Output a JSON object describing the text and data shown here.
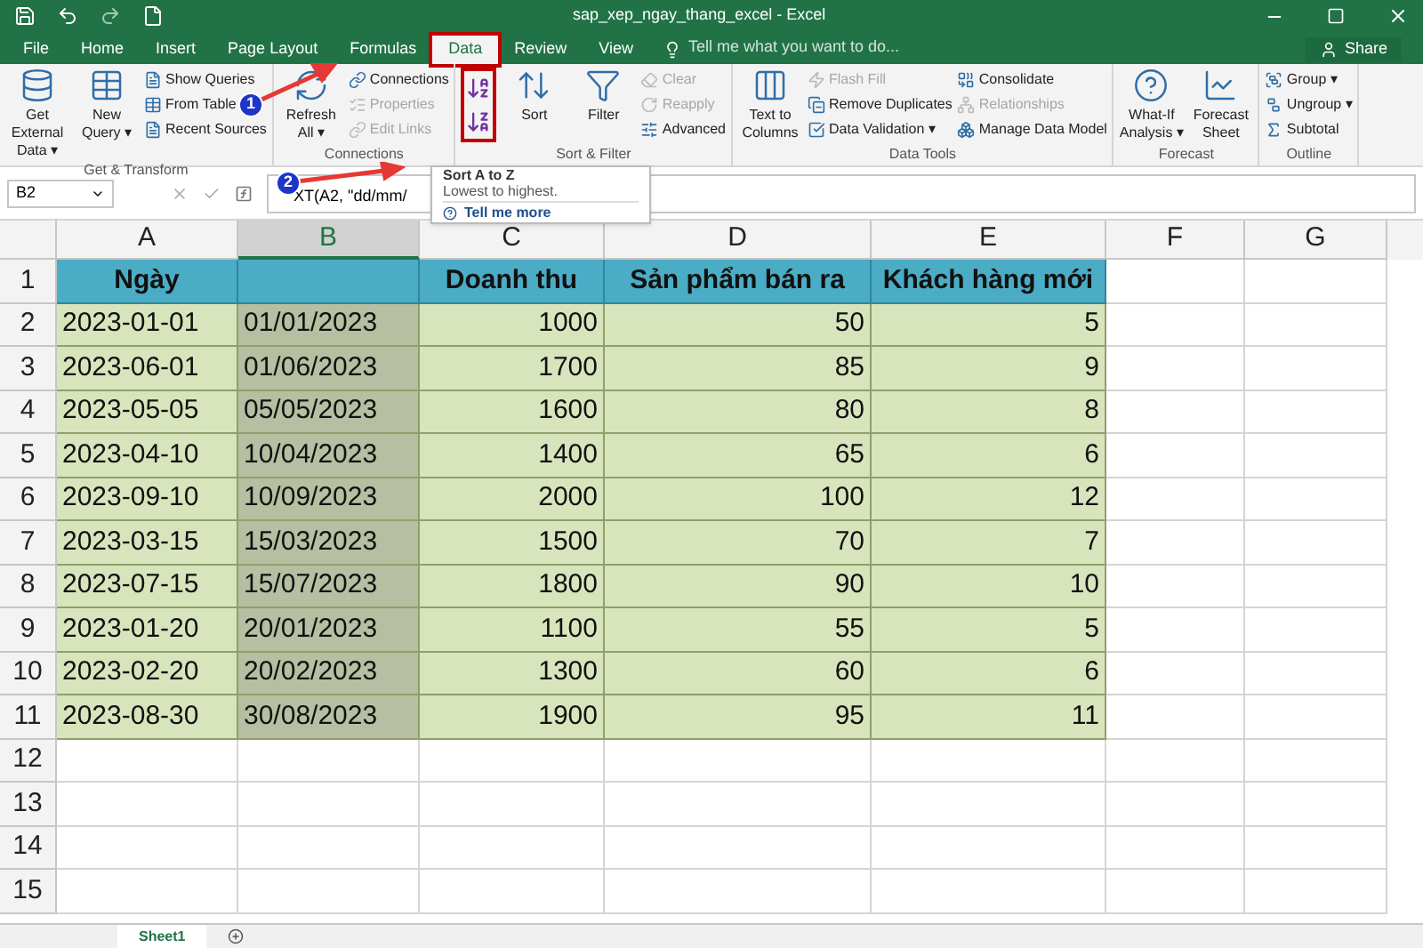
{
  "window": {
    "title": "sap_xep_ngay_thang_excel - Excel",
    "search_placeholder": "Tell me what you want to do...",
    "share": "Share"
  },
  "tabs": [
    {
      "label": "File",
      "selected": false
    },
    {
      "label": "Home",
      "selected": false
    },
    {
      "label": "Insert",
      "selected": false
    },
    {
      "label": "Page Layout",
      "selected": false
    },
    {
      "label": "Formulas",
      "selected": false
    },
    {
      "label": "Data",
      "selected": true
    },
    {
      "label": "Review",
      "selected": false
    },
    {
      "label": "View",
      "selected": false
    }
  ],
  "ribbon": [
    {
      "name": "Get & Transform",
      "items": [
        {
          "kind": "large",
          "label": "Get External Data ▾",
          "disabled": false
        },
        {
          "kind": "large",
          "label": "New Query ▾",
          "disabled": false
        },
        {
          "kind": "small",
          "label": "Show Queries",
          "disabled": false
        },
        {
          "kind": "small",
          "label": "From Table",
          "disabled": false
        },
        {
          "kind": "small",
          "label": "Recent Sources",
          "disabled": false
        }
      ]
    },
    {
      "name": "Connections",
      "items": [
        {
          "kind": "large",
          "label": "Refresh All ▾",
          "disabled": false
        },
        {
          "kind": "small",
          "label": "Connections",
          "disabled": false
        },
        {
          "kind": "small",
          "label": "Properties",
          "disabled": true
        },
        {
          "kind": "small",
          "label": "Edit Links",
          "disabled": true
        }
      ]
    },
    {
      "name": "Sort & Filter",
      "items": [
        {
          "kind": "sort",
          "disabled": false
        },
        {
          "kind": "large",
          "label": "Sort",
          "disabled": false
        },
        {
          "kind": "large",
          "label": "Filter",
          "disabled": false
        },
        {
          "kind": "small",
          "label": "Clear",
          "disabled": true
        },
        {
          "kind": "small",
          "label": "Reapply",
          "disabled": true
        },
        {
          "kind": "small",
          "label": "Advanced",
          "disabled": false
        }
      ]
    },
    {
      "name": "Data Tools",
      "items": [
        {
          "kind": "large",
          "label": "Text to Columns",
          "disabled": false
        },
        {
          "kind": "small",
          "label": "Flash Fill",
          "disabled": true
        },
        {
          "kind": "small",
          "label": "Remove Duplicates",
          "disabled": false
        },
        {
          "kind": "small",
          "label": "Data Validation ▾",
          "disabled": false
        },
        {
          "kind": "small",
          "label": "Consolidate",
          "disabled": false
        },
        {
          "kind": "small",
          "label": "Relationships",
          "disabled": true
        },
        {
          "kind": "small",
          "label": "Manage Data Model",
          "disabled": false
        }
      ]
    },
    {
      "name": "Forecast",
      "items": [
        {
          "kind": "large",
          "label": "What-If Analysis ▾",
          "disabled": false
        },
        {
          "kind": "large",
          "label": "Forecast Sheet",
          "disabled": false
        }
      ]
    },
    {
      "name": "Outline",
      "items": [
        {
          "kind": "small",
          "label": "Group ▾",
          "disabled": false
        },
        {
          "kind": "small",
          "label": "Ungroup ▾",
          "disabled": false
        },
        {
          "kind": "small",
          "label": "Subtotal",
          "disabled": false
        }
      ]
    }
  ],
  "formula_bar": {
    "name_box": "B2",
    "formula": "XT(A2, \"dd/mm/"
  },
  "tooltip": {
    "title": "Sort A to Z",
    "description": "Lowest to highest.",
    "link": "Tell me more"
  },
  "columns": [
    {
      "label": "A",
      "selected": false
    },
    {
      "label": "B",
      "selected": true
    },
    {
      "label": "C",
      "selected": false
    },
    {
      "label": "D",
      "selected": false
    },
    {
      "label": "E",
      "selected": false
    },
    {
      "label": "F",
      "selected": false
    },
    {
      "label": "G",
      "selected": false
    }
  ],
  "header_row": [
    {
      "kind": "text",
      "text": "Ngày"
    },
    {
      "kind": "empty"
    },
    {
      "kind": "text",
      "text": "Doanh thu"
    },
    {
      "kind": "text",
      "text": "Sản phẩm bán ra"
    },
    {
      "kind": "text",
      "text": "Khách hàng mới"
    }
  ],
  "rows": [
    [
      "2023-01-01",
      "01/01/2023",
      "1000",
      "50",
      "5"
    ],
    [
      "2023-06-01",
      "01/06/2023",
      "1700",
      "85",
      "9"
    ],
    [
      "2023-05-05",
      "05/05/2023",
      "1600",
      "80",
      "8"
    ],
    [
      "2023-04-10",
      "10/04/2023",
      "1400",
      "65",
      "6"
    ],
    [
      "2023-09-10",
      "10/09/2023",
      "2000",
      "100",
      "12"
    ],
    [
      "2023-03-15",
      "15/03/2023",
      "1500",
      "70",
      "7"
    ],
    [
      "2023-07-15",
      "15/07/2023",
      "1800",
      "90",
      "10"
    ],
    [
      "2023-01-20",
      "20/01/2023",
      "1100",
      "55",
      "5"
    ],
    [
      "2023-02-20",
      "20/02/2023",
      "1300",
      "60",
      "6"
    ],
    [
      "2023-08-30",
      "30/08/2023",
      "1900",
      "95",
      "11"
    ]
  ],
  "row_numbers": [
    "1",
    "2",
    "3",
    "4",
    "5",
    "6",
    "7",
    "8",
    "9",
    "10",
    "11",
    "12",
    "13",
    "14",
    "15"
  ],
  "sheets": [
    {
      "label": "Sheet1",
      "selected": true
    }
  ],
  "badges": [
    "1",
    "2"
  ]
}
